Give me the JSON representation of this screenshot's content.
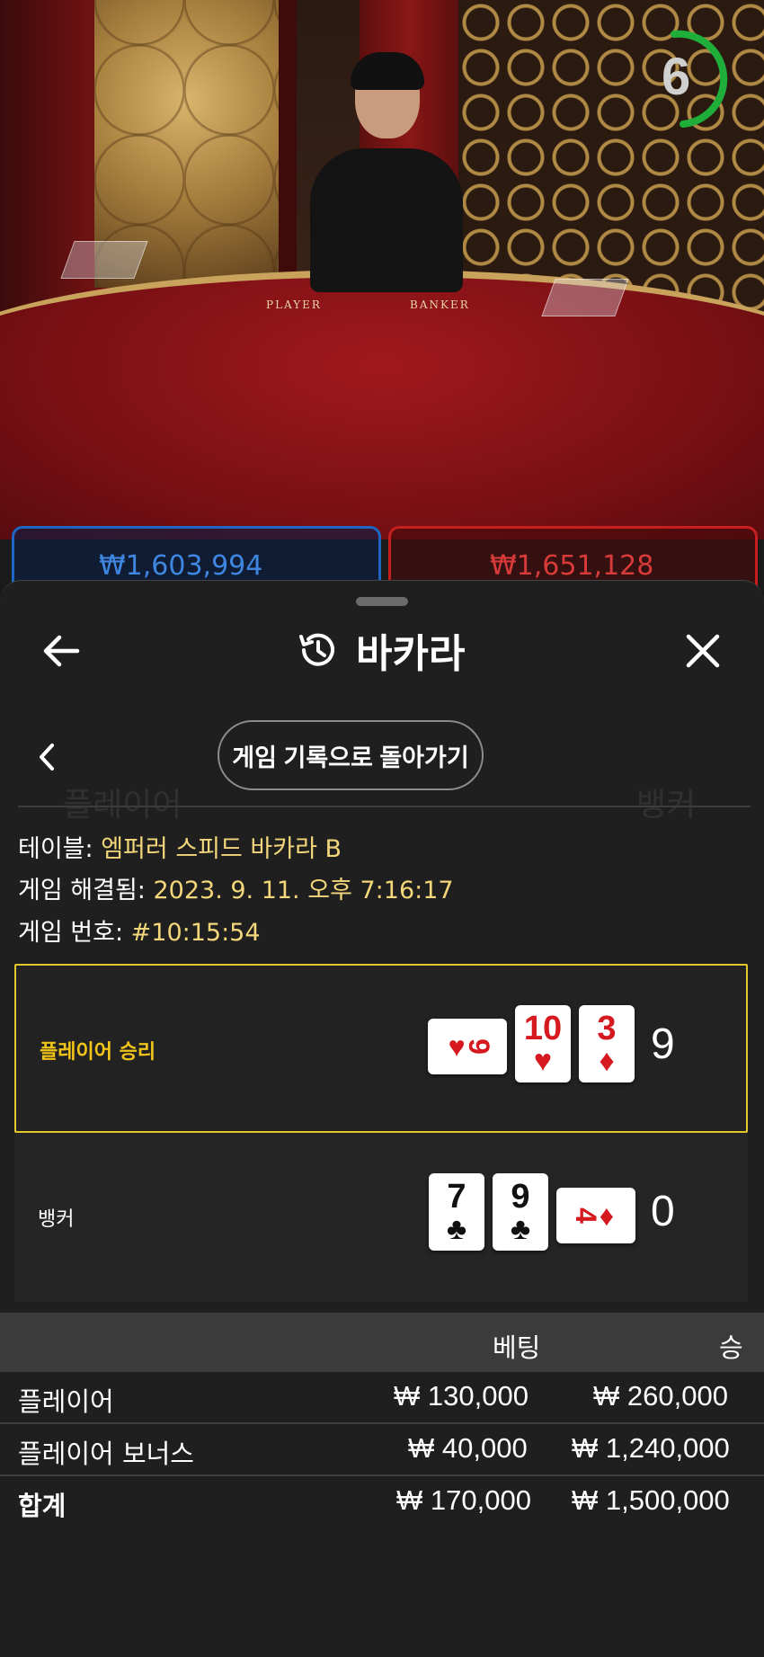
{
  "live": {
    "timer": "6",
    "table_text_player": "PLAYER",
    "table_text_banker": "BANKER",
    "player_pot": "₩1,603,994",
    "banker_pot": "₩1,651,128"
  },
  "header": {
    "title": "바카라",
    "return_button": "게임 기록으로 돌아가기"
  },
  "info": {
    "table_label": "테이블:",
    "table_value": "엠퍼러 스피드 바카라 B",
    "resolved_label": "게임 해결됨:",
    "resolved_value": "2023. 9. 11. 오후 7:16:17",
    "round_label": "게임 번호:",
    "round_value": "#10:15:54"
  },
  "hands": {
    "player": {
      "label": "플레이어 승리",
      "total": "9",
      "cards": [
        {
          "rank": "9",
          "suit": "♥",
          "color": "red",
          "orientation": "sideways"
        },
        {
          "rank": "10",
          "suit": "♥",
          "color": "red",
          "orientation": "upright"
        },
        {
          "rank": "3",
          "suit": "♦",
          "color": "red",
          "orientation": "upright"
        }
      ]
    },
    "banker": {
      "label": "뱅커",
      "total": "0",
      "cards": [
        {
          "rank": "7",
          "suit": "♣",
          "color": "black",
          "orientation": "upright"
        },
        {
          "rank": "9",
          "suit": "♣",
          "color": "black",
          "orientation": "upright"
        },
        {
          "rank": "4",
          "suit": "♦",
          "color": "red",
          "orientation": "sideways"
        }
      ]
    }
  },
  "bets": {
    "headers": {
      "bet": "베팅",
      "win": "승"
    },
    "rows": [
      {
        "name": "플레이어",
        "bet": "₩ 130,000",
        "win": "₩ 260,000"
      },
      {
        "name": "플레이어 보너스",
        "bet": "₩ 40,000",
        "win": "₩ 1,240,000"
      }
    ],
    "total": {
      "name": "합계",
      "bet": "₩ 170,000",
      "win": "₩ 1,500,000"
    }
  },
  "colors": {
    "highlight": "#e5c72a",
    "info_value": "#f3d77a",
    "card_red": "#d6181f",
    "timer_ring": "#1fae3a"
  }
}
